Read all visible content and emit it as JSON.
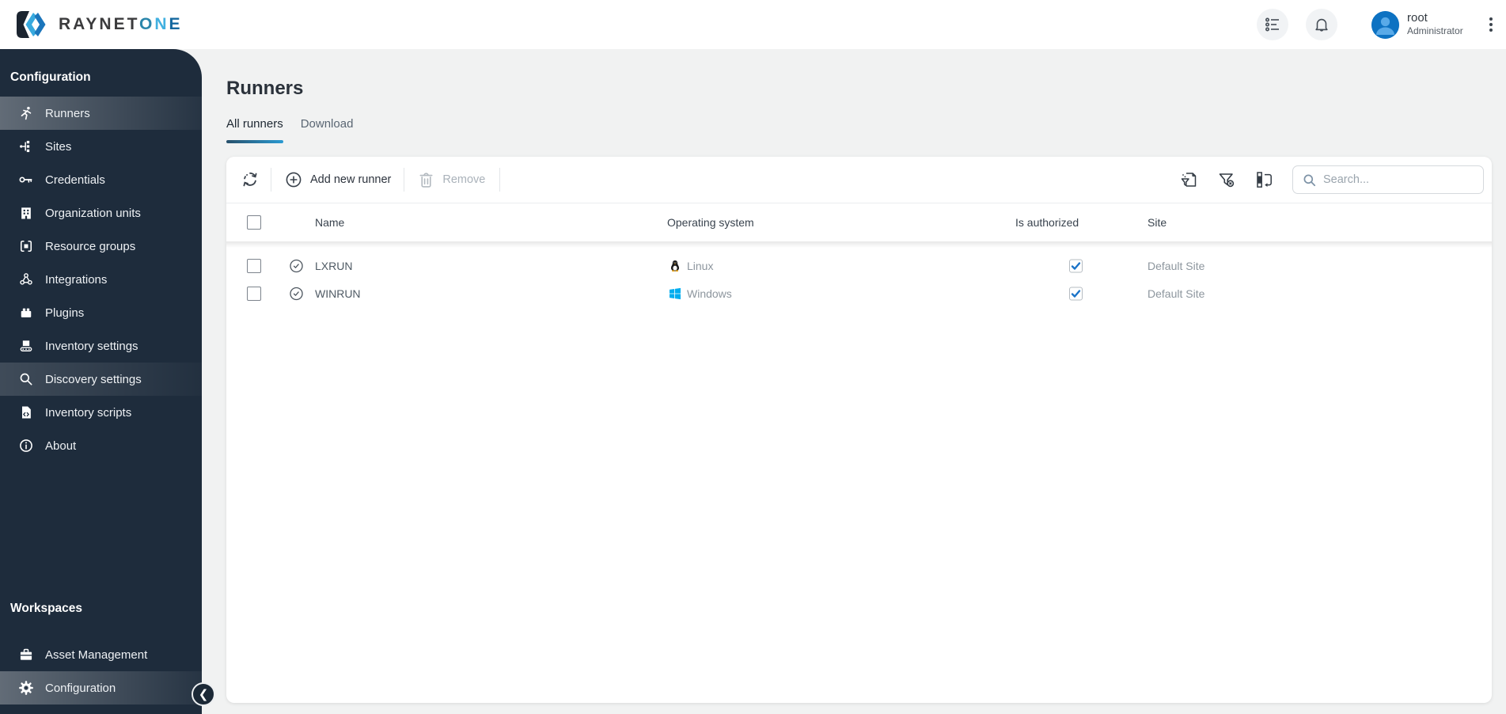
{
  "brand": {
    "word_primary": "RAYNET",
    "one_letters": [
      "O",
      "N",
      "E"
    ]
  },
  "topbar": {
    "user_name": "root",
    "user_role": "Administrator"
  },
  "sidebar": {
    "section_title": "Configuration",
    "items": [
      {
        "label": "Runners",
        "icon": "runner-icon",
        "state": "selected"
      },
      {
        "label": "Sites",
        "icon": "sites-icon",
        "state": "normal"
      },
      {
        "label": "Credentials",
        "icon": "key-icon",
        "state": "normal"
      },
      {
        "label": "Organization units",
        "icon": "building-icon",
        "state": "normal"
      },
      {
        "label": "Resource groups",
        "icon": "resource-groups-icon",
        "state": "normal"
      },
      {
        "label": "Integrations",
        "icon": "integrations-icon",
        "state": "normal"
      },
      {
        "label": "Plugins",
        "icon": "plugin-icon",
        "state": "normal"
      },
      {
        "label": "Inventory settings",
        "icon": "inventory-settings-icon",
        "state": "normal"
      },
      {
        "label": "Discovery settings",
        "icon": "magnifier-icon",
        "state": "hover"
      },
      {
        "label": "Inventory scripts",
        "icon": "script-icon",
        "state": "normal"
      },
      {
        "label": "About",
        "icon": "info-icon",
        "state": "normal"
      }
    ],
    "workspaces_title": "Workspaces",
    "workspaces": [
      {
        "label": "Asset Management",
        "icon": "briefcase-icon",
        "state": "normal"
      },
      {
        "label": "Configuration",
        "icon": "gear-icon",
        "state": "selected"
      }
    ]
  },
  "page": {
    "title": "Runners",
    "tabs": [
      {
        "label": "All runners",
        "active": true
      },
      {
        "label": "Download",
        "active": false
      }
    ]
  },
  "toolbar": {
    "refresh_icon": "refresh-icon",
    "add_label": "Add new runner",
    "remove_label": "Remove",
    "right_icons": [
      "export-filter-icon",
      "clear-filter-icon",
      "choose-columns-icon"
    ],
    "search_placeholder": "Search..."
  },
  "table": {
    "columns": [
      "Name",
      "Operating system",
      "Is authorized",
      "Site"
    ],
    "rows": [
      {
        "name": "LXRUN",
        "os": "Linux",
        "os_icon": "linux-icon",
        "authorized": true,
        "site": "Default Site"
      },
      {
        "name": "WINRUN",
        "os": "Windows",
        "os_icon": "windows-icon",
        "authorized": true,
        "site": "Default Site"
      }
    ]
  },
  "colors": {
    "sidebar_bg": "#1e2c3c",
    "accent_blue": "#2a9ad2",
    "windows_blue": "#00adef",
    "check_blue": "#1a73c8",
    "page_bg": "#f1f2f2"
  }
}
